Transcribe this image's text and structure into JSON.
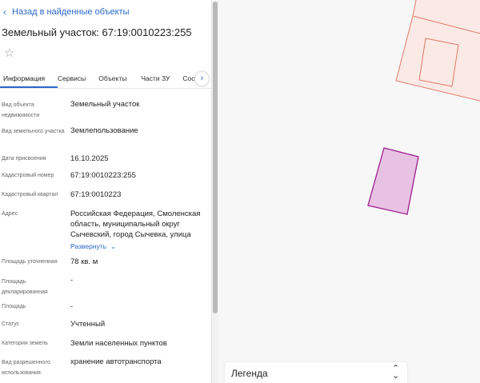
{
  "panel": {
    "back_label": "Назад в найденные объекты",
    "title": "Земельный участок: 67:19:0010223:255",
    "star_icon": "star-outline-icon",
    "tabs": [
      {
        "label": "Информация",
        "active": true
      },
      {
        "label": "Сервисы",
        "active": false
      },
      {
        "label": "Объекты",
        "active": false
      },
      {
        "label": "Части ЗУ",
        "active": false
      },
      {
        "label": "Состав",
        "active": false
      }
    ],
    "tab_scroll_icon": "chevron-right-icon"
  },
  "info": {
    "rows": [
      {
        "label": "Вид объекта недвижимости",
        "value": "Земельный участок"
      },
      {
        "label": "Вид земельного участка",
        "value": "Землепользование"
      },
      {
        "label": "Дата присвоения",
        "value": "16.10.2025"
      },
      {
        "label": "Кадастровый номер",
        "value": "67:19:0010223:255"
      },
      {
        "label": "Кадастровый квартал",
        "value": "67:19:0010223"
      },
      {
        "label": "Адрес",
        "value": "Российская Федерация, Смоленская область, муниципальный округ Сычевский, город Сычевка, улица",
        "expand_label": "Развернуть"
      },
      {
        "label": "Площадь уточненная",
        "value": "78 кв. м"
      },
      {
        "label": "Площадь декларированная",
        "value": "-"
      },
      {
        "label": "Площадь",
        "value": "-"
      },
      {
        "label": "Статус",
        "value": "Учтенный"
      },
      {
        "label": "Категория земель",
        "value": "Земли населенных пунктов"
      },
      {
        "label": "Вид разрешенного использования",
        "value": "хранение автотранспорта"
      }
    ]
  },
  "map": {
    "legend_label": "Легенда",
    "legend_icon": "sort-arrows-icon",
    "parcel_fill": "#e8c2e2",
    "parcel_stroke": "#9c1f8f",
    "building_stroke": "#e07a6a",
    "building_fill": "#fbe9e5"
  }
}
